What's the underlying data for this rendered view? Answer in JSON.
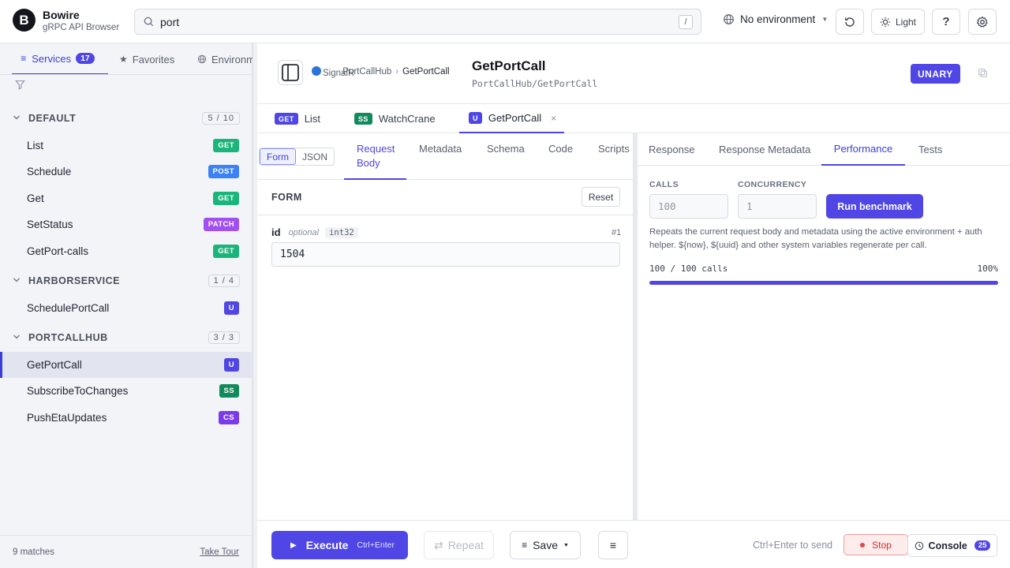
{
  "app": {
    "name": "Bowire",
    "subtitle": "gRPC API Browser",
    "logo_letter": "B"
  },
  "search": {
    "value": "port",
    "shortcut": "/"
  },
  "toolbar": {
    "environment": "No environment",
    "theme_label": "Light",
    "help": "?"
  },
  "sidebar": {
    "tabs": [
      {
        "label": "Services",
        "count": "17"
      },
      {
        "label": "Favorites"
      },
      {
        "label": "Environments"
      }
    ],
    "groups": [
      {
        "name": "DEFAULT",
        "count": "5 / 10",
        "items": [
          {
            "label": "List",
            "method": "GET"
          },
          {
            "label": "Schedule",
            "method": "POST"
          },
          {
            "label": "Get",
            "method": "GET"
          },
          {
            "label": "SetStatus",
            "method": "PATCH"
          },
          {
            "label": "GetPort-calls",
            "method": "GET"
          }
        ]
      },
      {
        "name": "HARBORSERVICE",
        "count": "1 / 4",
        "items": [
          {
            "label": "SchedulePortCall",
            "method": "U"
          }
        ]
      },
      {
        "name": "PORTCALLHUB",
        "count": "3 / 3",
        "items": [
          {
            "label": "GetPortCall",
            "method": "U",
            "selected": true
          },
          {
            "label": "SubscribeToChanges",
            "method": "SS"
          },
          {
            "label": "PushEtaUpdates",
            "method": "CS"
          }
        ]
      }
    ],
    "footer": {
      "matches": "9 matches",
      "tour": "Take Tour"
    }
  },
  "method_colors": {
    "GET": "#1bb57c",
    "POST": "#3b82f6",
    "PATCH": "#a24ff0",
    "U": "#4f46e5",
    "SS": "#128a5c",
    "CS": "#7c3aed"
  },
  "header": {
    "protocol": "SignalR",
    "breadcrumb": [
      "PortCallHub",
      "GetPortCall"
    ],
    "title": "GetPortCall",
    "path": "PortCallHub/GetPortCall",
    "kind": "UNARY"
  },
  "request_tabs": [
    {
      "badge": "GET",
      "label": "List"
    },
    {
      "badge": "SS",
      "label": "WatchCrane"
    },
    {
      "badge": "U",
      "label": "GetPortCall",
      "close": "×"
    }
  ],
  "editor": {
    "modes": [
      "Form",
      "JSON"
    ],
    "tabs": [
      "Request Body",
      "Metadata",
      "Schema",
      "Code",
      "Scripts"
    ],
    "request_body_line1": "Request",
    "request_body_line2": "Body",
    "form_title": "FORM",
    "reset": "Reset",
    "field": {
      "name": "id",
      "optional": "optional",
      "type": "int32",
      "number": "#1",
      "value": "1504"
    }
  },
  "response": {
    "tabs": [
      "Response",
      "Response Metadata",
      "Performance",
      "Tests"
    ],
    "calls_label": "CALLS",
    "calls_placeholder": "100",
    "concurrency_label": "CONCURRENCY",
    "concurrency_placeholder": "1",
    "run": "Run benchmark",
    "note": "Repeats the current request body and metadata using the active environment + auth helper. ${now}, ${uuid} and other system variables regenerate per call.",
    "progress_text": "100 / 100 calls",
    "progress_pct": "100%",
    "progress_fraction": 1.0
  },
  "footer": {
    "execute": "Execute",
    "execute_hint": "Ctrl+Enter",
    "repeat": "Repeat",
    "save": "Save",
    "send_hint": "Ctrl+Enter to send",
    "stop": "Stop",
    "console": "Console",
    "console_count": "25"
  }
}
